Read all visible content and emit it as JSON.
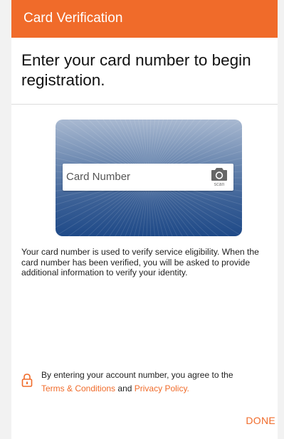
{
  "app_bar": {
    "title": "Card Verification"
  },
  "main": {
    "heading": "Enter your card number to begin registration.",
    "card": {
      "placeholder": "Card Number",
      "scan_label": "scan",
      "scan_icon": "camera-icon",
      "gradient_top": "#a9b9d1",
      "gradient_bottom": "#1f4a88"
    },
    "info_text": "Your card number is used to verify service eligibility. When the card number has been verified, you will be asked to provide additional information to verify your identity."
  },
  "footer": {
    "lock_icon": "lock-icon",
    "terms_prefix": "By entering your account number, you agree to the",
    "terms_link": "Terms & Conditions",
    "terms_and": "and",
    "privacy_link": "Privacy Policy.",
    "done_label": "DONE"
  },
  "colors": {
    "accent": "#f06b2a",
    "text": "#222222",
    "background": "#ffffff"
  }
}
